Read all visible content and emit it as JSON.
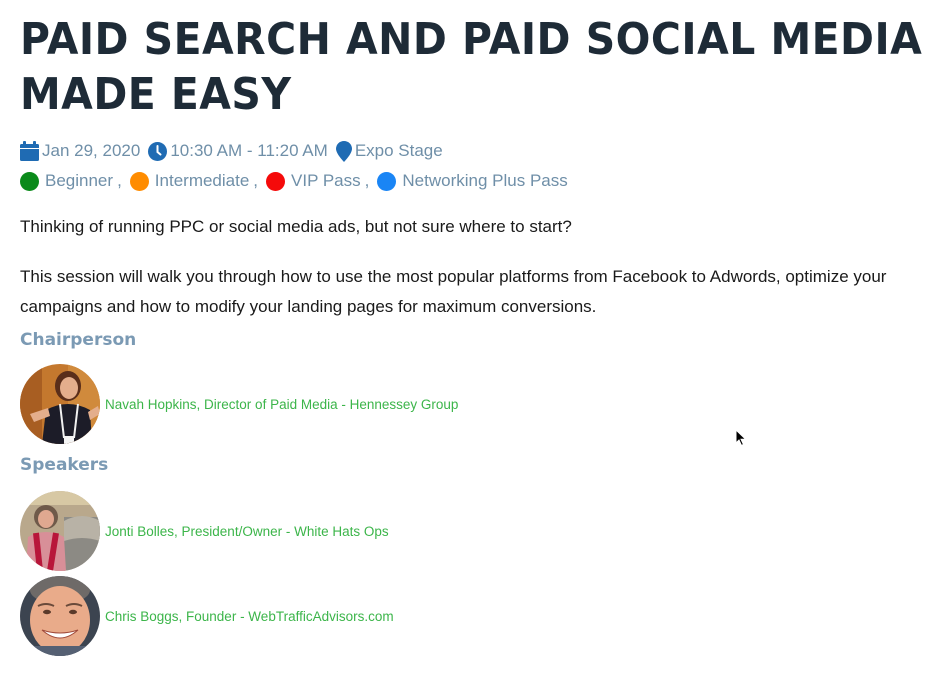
{
  "session": {
    "title": "PAID SEARCH AND PAID SOCIAL MEDIA MADE EASY",
    "date": "Jan 29, 2020",
    "time": "10:30 AM - 11:20 AM",
    "location": "Expo Stage",
    "icons": {
      "date": "calendar-icon",
      "time": "clock-icon",
      "location": "map-pin-icon"
    },
    "tags": [
      {
        "label": "Beginner",
        "color": "#0a8a1a"
      },
      {
        "label": "Intermediate",
        "color": "#ff8c00"
      },
      {
        "label": "VIP Pass",
        "color": "#f50a0a"
      },
      {
        "label": "Networking Plus Pass",
        "color": "#1a85f5"
      }
    ],
    "tag_separator": ",",
    "description": [
      "Thinking of running PPC or social media ads, but not sure where to start?",
      "This session will walk you through how to use the most popular platforms from Facebook to Adwords, optimize your campaigns and how to modify your landing pages for maximum conversions."
    ]
  },
  "chairperson": {
    "heading": "Chairperson",
    "people": [
      {
        "label": "Navah Hopkins, Director of Paid Media - Hennessey Group"
      }
    ]
  },
  "speakers": {
    "heading": "Speakers",
    "people": [
      {
        "label": "Jonti Bolles, President/Owner - White Hats Ops"
      },
      {
        "label": "Chris Boggs, Founder - WebTrafficAdvisors.com"
      }
    ]
  },
  "colors": {
    "title": "#1e2b37",
    "meta_text": "#6f8fa8",
    "meta_icon": "#1f6bb3",
    "section_heading": "#7b9ab4",
    "person_link": "#3cb54a"
  }
}
